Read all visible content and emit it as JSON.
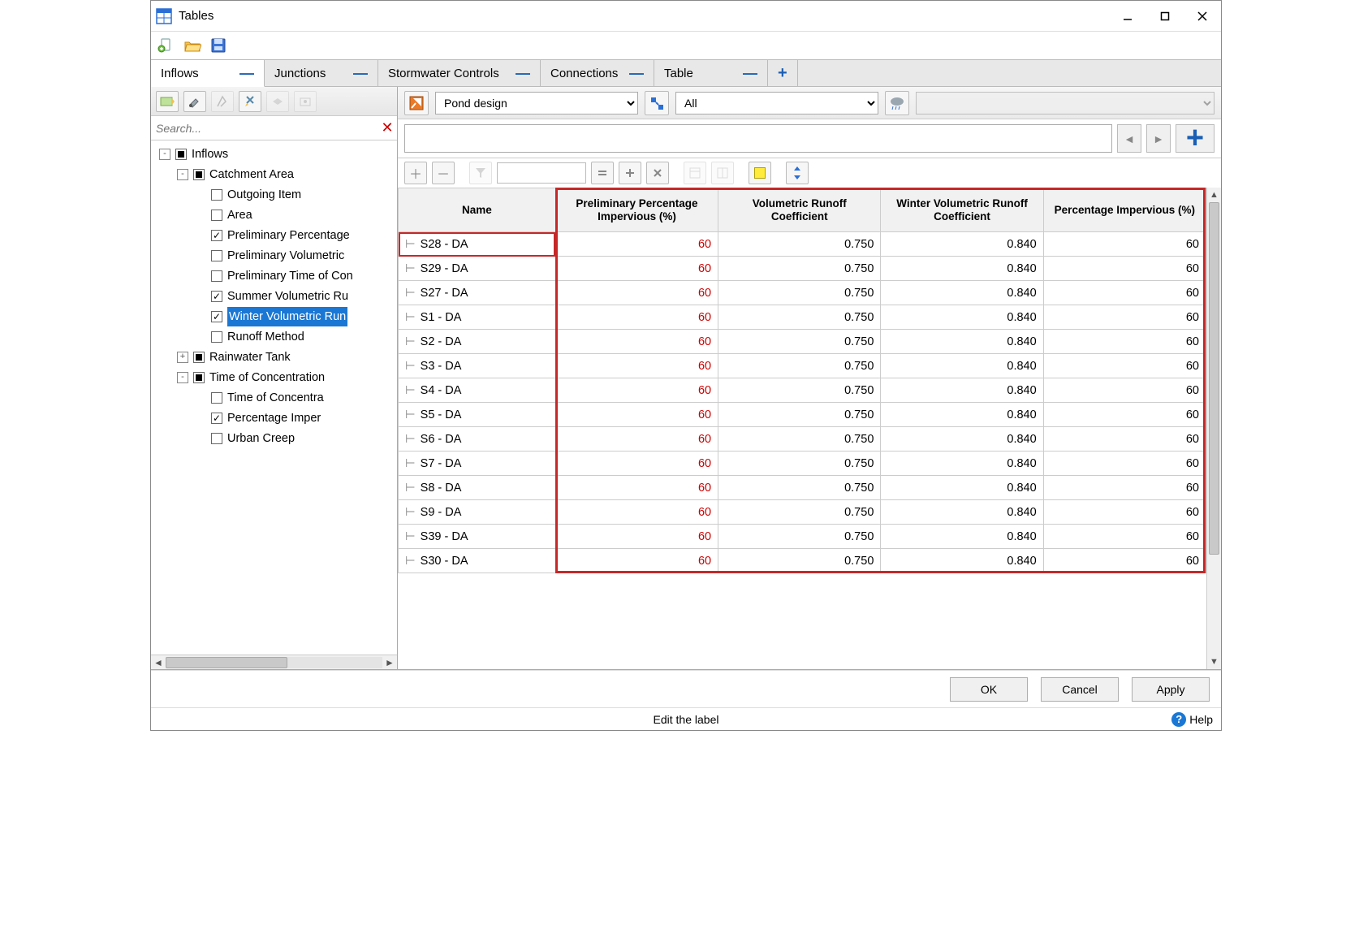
{
  "window": {
    "title": "Tables"
  },
  "tabs": [
    {
      "label": "Inflows",
      "active": true
    },
    {
      "label": "Junctions",
      "active": false
    },
    {
      "label": "Stormwater Controls",
      "active": false
    },
    {
      "label": "Connections",
      "active": false
    },
    {
      "label": "Table",
      "active": false
    }
  ],
  "search": {
    "placeholder": "Search..."
  },
  "tree": [
    {
      "depth": 0,
      "exp": "-",
      "cb": "mixed",
      "label": "Inflows"
    },
    {
      "depth": 1,
      "exp": "-",
      "cb": "mixed",
      "label": "Catchment Area"
    },
    {
      "depth": 2,
      "exp": "",
      "cb": "off",
      "label": "Outgoing Item"
    },
    {
      "depth": 2,
      "exp": "",
      "cb": "off",
      "label": "Area"
    },
    {
      "depth": 2,
      "exp": "",
      "cb": "on",
      "label": "Preliminary Percentage"
    },
    {
      "depth": 2,
      "exp": "",
      "cb": "off",
      "label": "Preliminary Volumetric"
    },
    {
      "depth": 2,
      "exp": "",
      "cb": "off",
      "label": "Preliminary Time of Con"
    },
    {
      "depth": 2,
      "exp": "",
      "cb": "on",
      "label": "Summer Volumetric Ru"
    },
    {
      "depth": 2,
      "exp": "",
      "cb": "on",
      "label": "Winter Volumetric Run",
      "selected": true
    },
    {
      "depth": 2,
      "exp": "",
      "cb": "off",
      "label": "Runoff Method"
    },
    {
      "depth": 1,
      "exp": "+",
      "cb": "mixed",
      "label": "Rainwater Tank"
    },
    {
      "depth": 1,
      "exp": "-",
      "cb": "mixed",
      "label": "Time of Concentration"
    },
    {
      "depth": 2,
      "exp": "",
      "cb": "off",
      "label": "Time of Concentra"
    },
    {
      "depth": 2,
      "exp": "",
      "cb": "on",
      "label": "Percentage Imper"
    },
    {
      "depth": 2,
      "exp": "",
      "cb": "off",
      "label": "Urban Creep"
    }
  ],
  "controls": {
    "plan_dropdown": "Pond design",
    "filter_dropdown": "All"
  },
  "grid": {
    "columns": [
      "Name",
      "Preliminary Percentage Impervious (%)",
      "Volumetric Runoff Coefficient",
      "Winter Volumetric Runoff Coefficient",
      "Percentage Impervious (%)"
    ],
    "rows": [
      {
        "name": "S28 - DA",
        "prelim_pct": "60",
        "vol_runoff": "0.750",
        "winter_vol": "0.840",
        "pct_imp": "60",
        "selected": true
      },
      {
        "name": "S29 - DA",
        "prelim_pct": "60",
        "vol_runoff": "0.750",
        "winter_vol": "0.840",
        "pct_imp": "60"
      },
      {
        "name": "S27 - DA",
        "prelim_pct": "60",
        "vol_runoff": "0.750",
        "winter_vol": "0.840",
        "pct_imp": "60"
      },
      {
        "name": "S1 - DA",
        "prelim_pct": "60",
        "vol_runoff": "0.750",
        "winter_vol": "0.840",
        "pct_imp": "60"
      },
      {
        "name": "S2 - DA",
        "prelim_pct": "60",
        "vol_runoff": "0.750",
        "winter_vol": "0.840",
        "pct_imp": "60"
      },
      {
        "name": "S3 - DA",
        "prelim_pct": "60",
        "vol_runoff": "0.750",
        "winter_vol": "0.840",
        "pct_imp": "60"
      },
      {
        "name": "S4 - DA",
        "prelim_pct": "60",
        "vol_runoff": "0.750",
        "winter_vol": "0.840",
        "pct_imp": "60"
      },
      {
        "name": "S5 - DA",
        "prelim_pct": "60",
        "vol_runoff": "0.750",
        "winter_vol": "0.840",
        "pct_imp": "60"
      },
      {
        "name": "S6 - DA",
        "prelim_pct": "60",
        "vol_runoff": "0.750",
        "winter_vol": "0.840",
        "pct_imp": "60"
      },
      {
        "name": "S7 - DA",
        "prelim_pct": "60",
        "vol_runoff": "0.750",
        "winter_vol": "0.840",
        "pct_imp": "60"
      },
      {
        "name": "S8 - DA",
        "prelim_pct": "60",
        "vol_runoff": "0.750",
        "winter_vol": "0.840",
        "pct_imp": "60"
      },
      {
        "name": "S9 - DA",
        "prelim_pct": "60",
        "vol_runoff": "0.750",
        "winter_vol": "0.840",
        "pct_imp": "60"
      },
      {
        "name": "S39 - DA",
        "prelim_pct": "60",
        "vol_runoff": "0.750",
        "winter_vol": "0.840",
        "pct_imp": "60"
      },
      {
        "name": "S30 - DA",
        "prelim_pct": "60",
        "vol_runoff": "0.750",
        "winter_vol": "0.840",
        "pct_imp": "60"
      }
    ]
  },
  "buttons": {
    "ok": "OK",
    "cancel": "Cancel",
    "apply": "Apply"
  },
  "status": {
    "text": "Edit the label",
    "help": "Help"
  }
}
